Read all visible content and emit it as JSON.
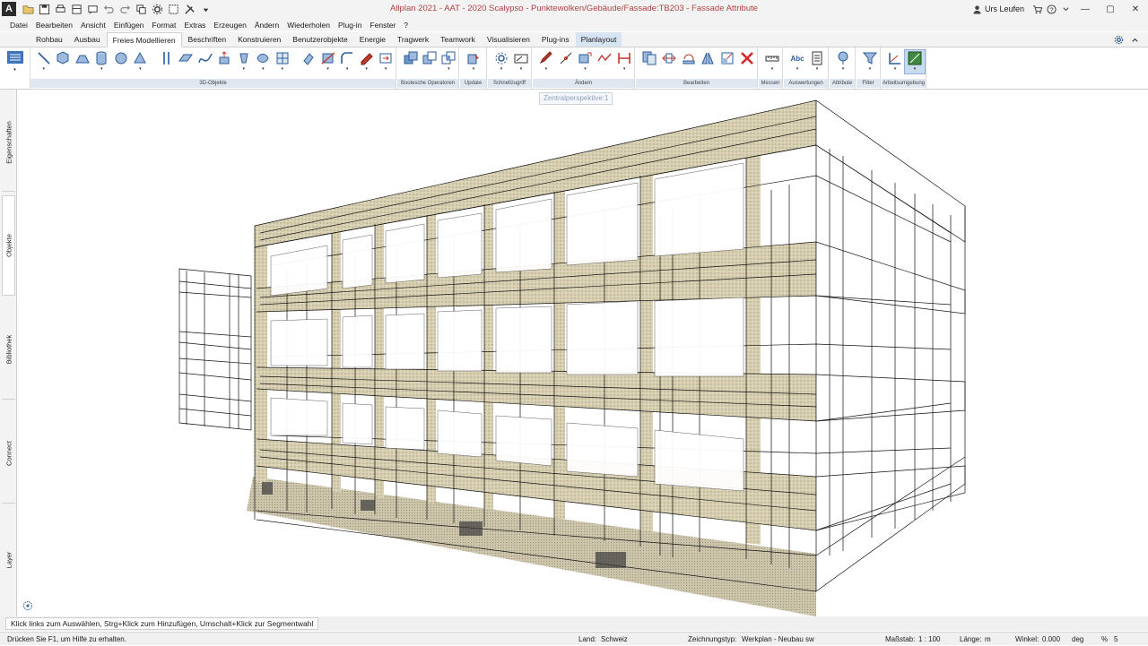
{
  "window": {
    "logo_letter": "A",
    "title": "Allplan 2021 - AAT - 2020 Scalypso - Punktewolken/Gebäude/Fassade:TB203 - Fassade Attribute",
    "user": "Urs Leufen",
    "minimize": "—",
    "maximize": "▢",
    "close": "✕"
  },
  "menu": [
    "Datei",
    "Bearbeiten",
    "Ansicht",
    "Einfügen",
    "Format",
    "Extras",
    "Erzeugen",
    "Ändern",
    "Wiederholen",
    "Plug-in",
    "Fenster",
    "?"
  ],
  "tabs": [
    {
      "label": "Rohbau"
    },
    {
      "label": "Ausbau"
    },
    {
      "label": "Freies Modellieren"
    },
    {
      "label": "Beschriften"
    },
    {
      "label": "Konstruieren"
    },
    {
      "label": "Benutzerobjekte"
    },
    {
      "label": "Energie"
    },
    {
      "label": "Tragwerk"
    },
    {
      "label": "Teamwork"
    },
    {
      "label": "Visualisieren"
    },
    {
      "label": "Plug-ins"
    },
    {
      "label": "Planlayout"
    }
  ],
  "ribbon_groups": [
    "3D-Objekte",
    "Boolesche Operatoren",
    "Update",
    "Schnellzugriff",
    "Ändern",
    "Bearbeiten",
    "Messen",
    "Auswertungen",
    "Attribute",
    "Filter",
    "Arbeitsumgebung"
  ],
  "side_tabs": [
    "Eigenschaften",
    "Objekte",
    "Bibliothek",
    "Connect",
    "Layer"
  ],
  "viewport": {
    "tooltip": "Zentralperspektive:1"
  },
  "prompt": "Klick links zum Auswählen, Strg+Klick zum Hinzufügen, Umschalt+Klick zur Segmentwahl",
  "status": {
    "help": "Drücken Sie F1, um Hilfe zu erhalten.",
    "land_label": "Land:",
    "land_value": "Schweiz",
    "drawing_type_label": "Zeichnungstyp:",
    "drawing_type_value": "Werkplan - Neubau sw",
    "scale_label": "Maßstab:",
    "scale_value": "1 : 100",
    "length_label": "Länge:",
    "length_value": "m",
    "angle_label": "Winkel:",
    "angle_value": "0.000",
    "angle_unit": "deg",
    "percent_label": "%",
    "percent_value": "5"
  },
  "colors": {
    "title_text": "#b24242",
    "accent_tab": "#d7e4f3",
    "group_label_bg": "#dfe7f1",
    "pointcloud": "#cfc6a4",
    "wireframe": "#111111"
  }
}
